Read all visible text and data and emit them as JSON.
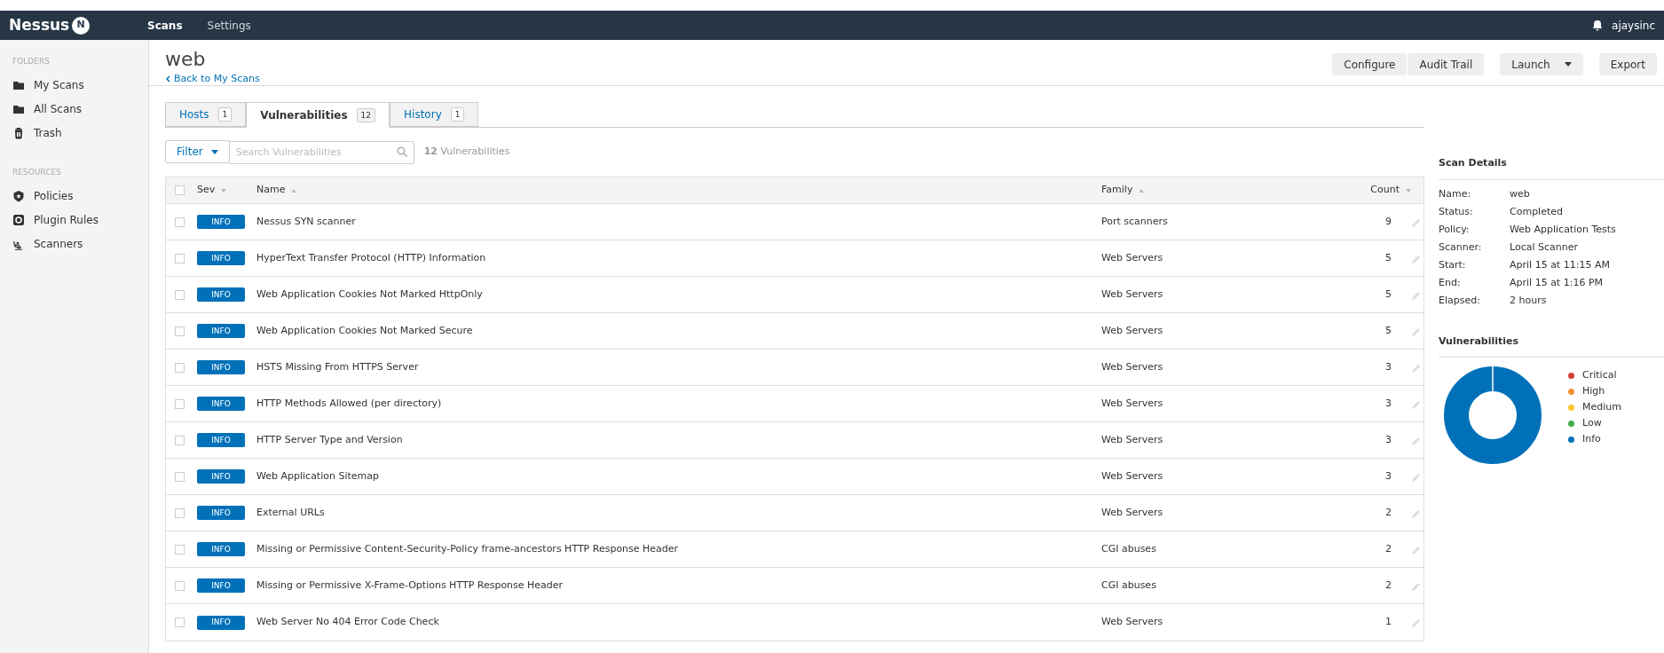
{
  "navbar": {
    "logo": "Nessus",
    "logo_badge": "N",
    "items": [
      {
        "label": "Scans",
        "selected": true
      },
      {
        "label": "Settings",
        "selected": false
      }
    ],
    "user": "ajaysinc"
  },
  "sidebar": {
    "sections": [
      {
        "title": "FOLDERS",
        "items": [
          {
            "label": "My Scans",
            "kind": "folder"
          },
          {
            "label": "All Scans",
            "kind": "folder"
          },
          {
            "label": "Trash",
            "kind": "trash"
          }
        ]
      },
      {
        "title": "RESOURCES",
        "items": [
          {
            "label": "Policies",
            "kind": "policy"
          },
          {
            "label": "Plugin Rules",
            "kind": "rules"
          },
          {
            "label": "Scanners",
            "kind": "scanner"
          }
        ]
      }
    ]
  },
  "header": {
    "title": "web",
    "back_link": "Back to My Scans",
    "buttons": [
      {
        "label": "Configure",
        "kind": "plain"
      },
      {
        "label": "Audit Trail",
        "kind": "plain"
      },
      {
        "label": "Launch",
        "kind": "dropdown"
      },
      {
        "label": "Export",
        "kind": "plain"
      }
    ]
  },
  "tabs": [
    {
      "label": "Hosts",
      "count": "1",
      "selected": false
    },
    {
      "label": "Vulnerabilities",
      "count": "12",
      "selected": true
    },
    {
      "label": "History",
      "count": "1",
      "selected": false
    }
  ],
  "filter": {
    "label": "Filter",
    "placeholder": "Search Vulnerabilities",
    "result_count": "12",
    "result_label": "Vulnerabilities"
  },
  "table": {
    "checked": false,
    "columns": [
      "Sev",
      "Name",
      "Family",
      "Count"
    ],
    "rows": [
      {
        "severity": "INFO",
        "name": "Nessus SYN scanner",
        "family": "Port scanners",
        "count": "9",
        "checked": false
      },
      {
        "severity": "INFO",
        "name": "HyperText Transfer Protocol (HTTP) Information",
        "family": "Web Servers",
        "count": "5",
        "checked": false
      },
      {
        "severity": "INFO",
        "name": "Web Application Cookies Not Marked HttpOnly",
        "family": "Web Servers",
        "count": "5",
        "checked": false
      },
      {
        "severity": "INFO",
        "name": "Web Application Cookies Not Marked Secure",
        "family": "Web Servers",
        "count": "5",
        "checked": false
      },
      {
        "severity": "INFO",
        "name": "HSTS Missing From HTTPS Server",
        "family": "Web Servers",
        "count": "3",
        "checked": false
      },
      {
        "severity": "INFO",
        "name": "HTTP Methods Allowed (per directory)",
        "family": "Web Servers",
        "count": "3",
        "checked": false
      },
      {
        "severity": "INFO",
        "name": "HTTP Server Type and Version",
        "family": "Web Servers",
        "count": "3",
        "checked": false
      },
      {
        "severity": "INFO",
        "name": "Web Application Sitemap",
        "family": "Web Servers",
        "count": "3",
        "checked": false
      },
      {
        "severity": "INFO",
        "name": "External URLs",
        "family": "Web Servers",
        "count": "2",
        "checked": false
      },
      {
        "severity": "INFO",
        "name": "Missing or Permissive Content-Security-Policy frame-ancestors HTTP Response Header",
        "family": "CGI abuses",
        "count": "2",
        "checked": false
      },
      {
        "severity": "INFO",
        "name": "Missing or Permissive X-Frame-Options HTTP Response Header",
        "family": "CGI abuses",
        "count": "2",
        "checked": false
      },
      {
        "severity": "INFO",
        "name": "Web Server No 404 Error Code Check",
        "family": "Web Servers",
        "count": "1",
        "checked": false
      }
    ]
  },
  "scan_details": {
    "title": "Scan Details",
    "fields": [
      {
        "label": "Name:",
        "value": "web"
      },
      {
        "label": "Status:",
        "value": "Completed"
      },
      {
        "label": "Policy:",
        "value": "Web Application Tests"
      },
      {
        "label": "Scanner:",
        "value": "Local Scanner"
      },
      {
        "label": "Start:",
        "value": "April 15 at 11:15 AM"
      },
      {
        "label": "End:",
        "value": "April 15 at 1:16 PM"
      },
      {
        "label": "Elapsed:",
        "value": "2 hours"
      }
    ]
  },
  "vulnerabilities_panel": {
    "title": "Vulnerabilities",
    "legend": [
      {
        "label": "Critical",
        "color": "#d43f3a"
      },
      {
        "label": "High",
        "color": "#ee9336"
      },
      {
        "label": "Medium",
        "color": "#fdc431"
      },
      {
        "label": "Low",
        "color": "#3fae49"
      },
      {
        "label": "Info",
        "color": "#0071b9"
      }
    ]
  }
}
